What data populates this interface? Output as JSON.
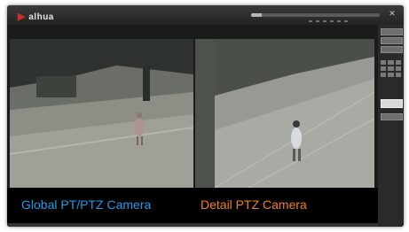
{
  "header": {
    "logo_mark": "▶",
    "logo_text": "alhua",
    "playback_progress": 0.08,
    "close_icon": "close-icon"
  },
  "views": {
    "global": {
      "caption": "Global PT/PTZ Camera",
      "caption_color": "#1e9be8"
    },
    "detail": {
      "caption": "Detail PTZ Camera",
      "caption_color": "#f07f1e"
    }
  },
  "side_panel": {
    "icons": [
      "layout-1-icon",
      "layout-4-icon",
      "layout-9-icon",
      "settings-icon",
      "ptz-icon"
    ]
  }
}
